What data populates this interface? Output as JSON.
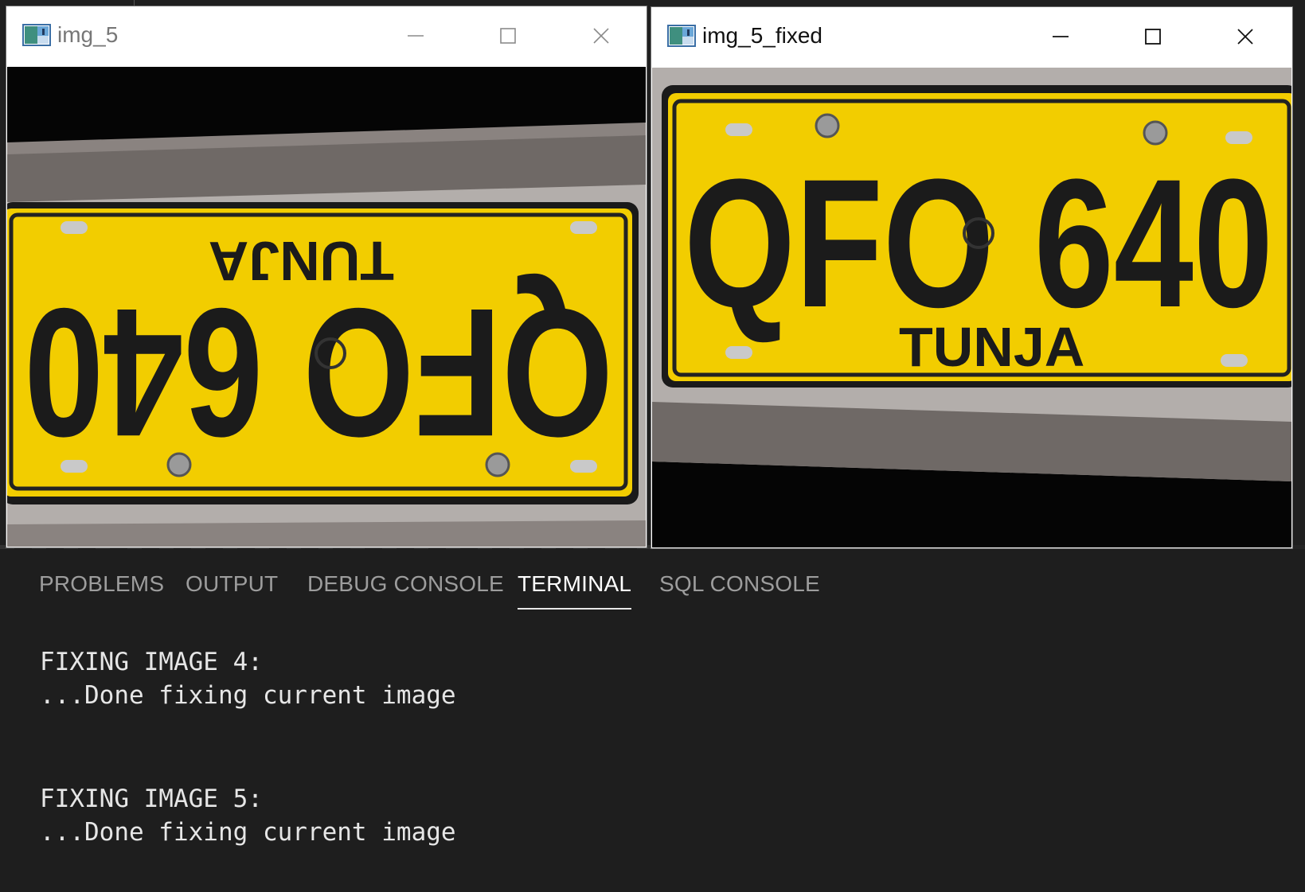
{
  "windows": {
    "left": {
      "title": "img_5",
      "plate": {
        "number": "QFO 640",
        "city": "TUNJA",
        "orientation": "upside-down"
      }
    },
    "right": {
      "title": "img_5_fixed",
      "plate": {
        "number": "QFO 640",
        "city": "TUNJA",
        "orientation": "upright"
      }
    },
    "controls": {
      "minimize": "minimize-icon",
      "maximize": "maximize-icon",
      "close": "close-icon"
    }
  },
  "panel": {
    "tabs": [
      {
        "label": "PROBLEMS",
        "active": false
      },
      {
        "label": "OUTPUT",
        "active": false
      },
      {
        "label": "DEBUG CONSOLE",
        "active": false
      },
      {
        "label": "TERMINAL",
        "active": true
      },
      {
        "label": "SQL CONSOLE",
        "active": false
      }
    ],
    "terminal": {
      "lines": [
        "FIXING IMAGE 4:",
        "...Done fixing current image",
        "FIXING IMAGE 5:",
        "...Done fixing current image"
      ]
    }
  },
  "colors": {
    "plate_yellow": "#f2cd00",
    "panel_bg": "#1e1e1e",
    "tab_inactive": "#9d9d9d",
    "tab_active": "#ffffff"
  }
}
